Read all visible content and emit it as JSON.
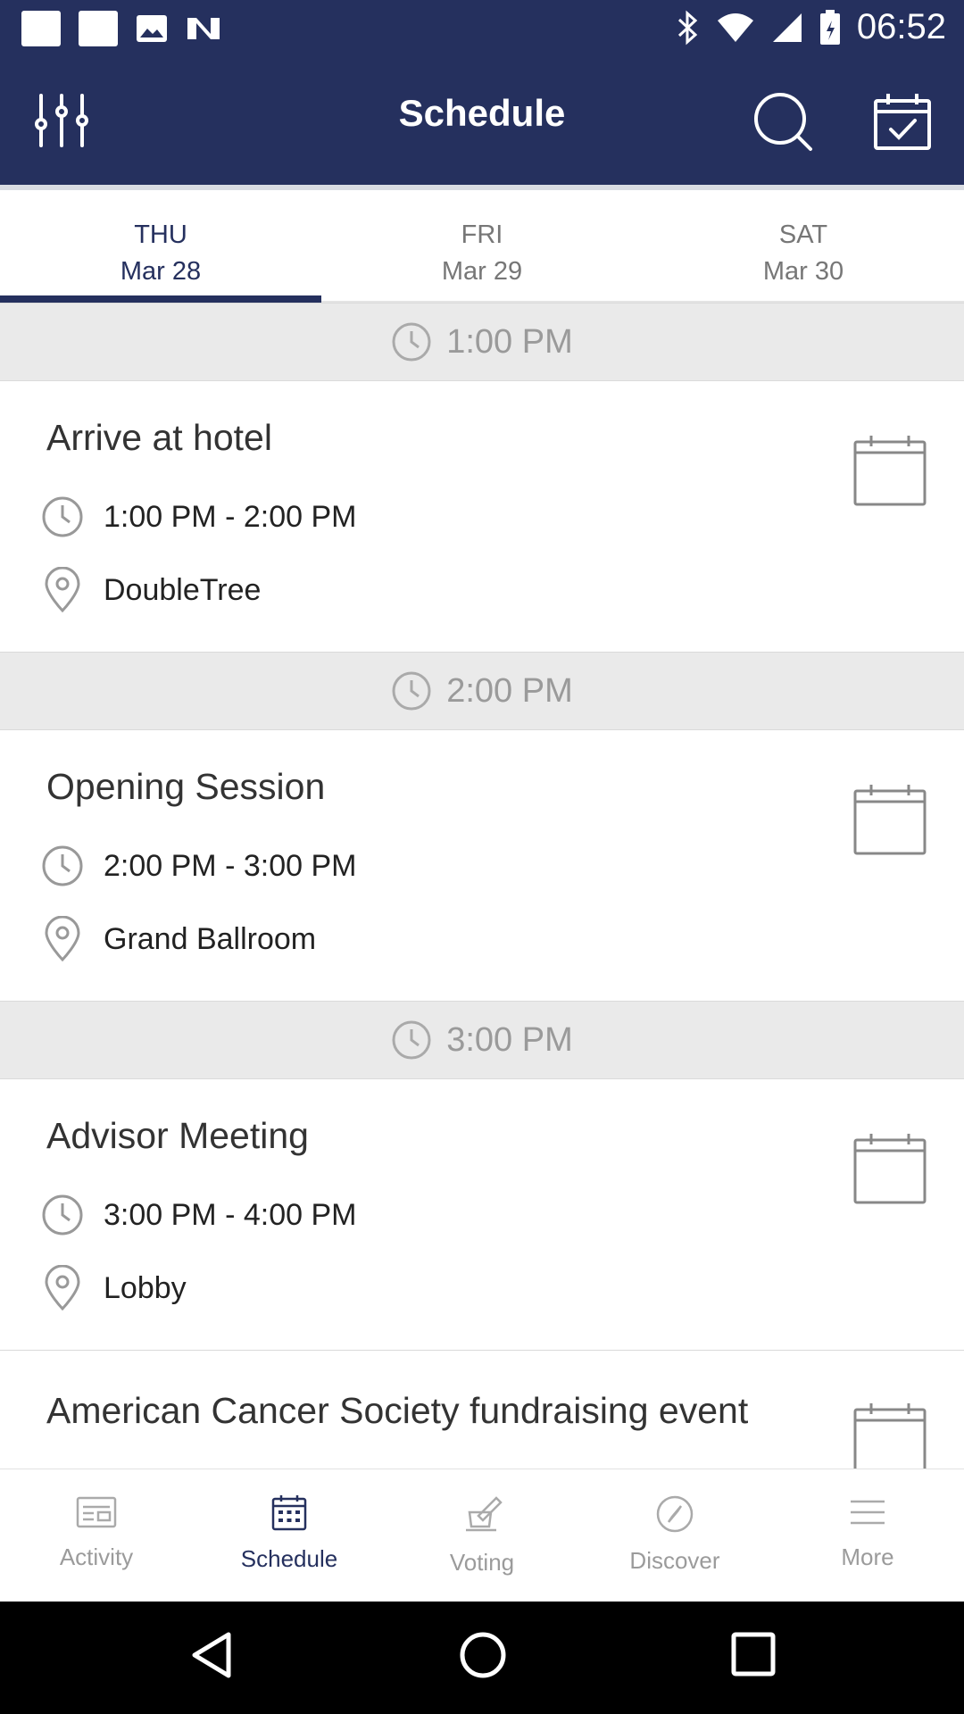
{
  "status_bar": {
    "time": "06:52",
    "notification_icons": [
      "square-icon",
      "square-icon",
      "image-icon",
      "n-logo-icon"
    ],
    "system_icons": [
      "bluetooth-icon",
      "wifi-icon",
      "signal-icon",
      "battery-icon"
    ]
  },
  "app_bar": {
    "title": "Schedule",
    "icons": [
      "filter-sliders-icon",
      "search-icon",
      "calendar-check-icon"
    ]
  },
  "date_tabs": [
    {
      "dow": "THU",
      "date": "Mar 28",
      "active": true
    },
    {
      "dow": "FRI",
      "date": "Mar 29",
      "active": false
    },
    {
      "dow": "SAT",
      "date": "Mar 30",
      "active": false
    }
  ],
  "schedule": [
    {
      "header": "1:00 PM",
      "title": "Arrive at hotel",
      "time": "1:00 PM - 2:00 PM",
      "location": "DoubleTree"
    },
    {
      "header": "2:00 PM",
      "title": "Opening Session",
      "time": "2:00 PM - 3:00 PM",
      "location": "Grand Ballroom"
    },
    {
      "header": "3:00 PM",
      "title": "Advisor Meeting",
      "time": "3:00 PM - 4:00 PM",
      "location": "Lobby"
    },
    {
      "header": "",
      "title": "American Cancer Society fundraising event",
      "time": "",
      "location": ""
    }
  ],
  "bottom_nav": [
    {
      "label": "Activity",
      "icon": "activity-icon",
      "active": false
    },
    {
      "label": "Schedule",
      "icon": "schedule-icon",
      "active": true
    },
    {
      "label": "Voting",
      "icon": "voting-icon",
      "active": false
    },
    {
      "label": "Discover",
      "icon": "compass-icon",
      "active": false
    },
    {
      "label": "More",
      "icon": "menu-icon",
      "active": false
    }
  ],
  "colors": {
    "primary": "#25305e",
    "header_bg": "#eaeaea",
    "muted": "#9b9b9b"
  }
}
